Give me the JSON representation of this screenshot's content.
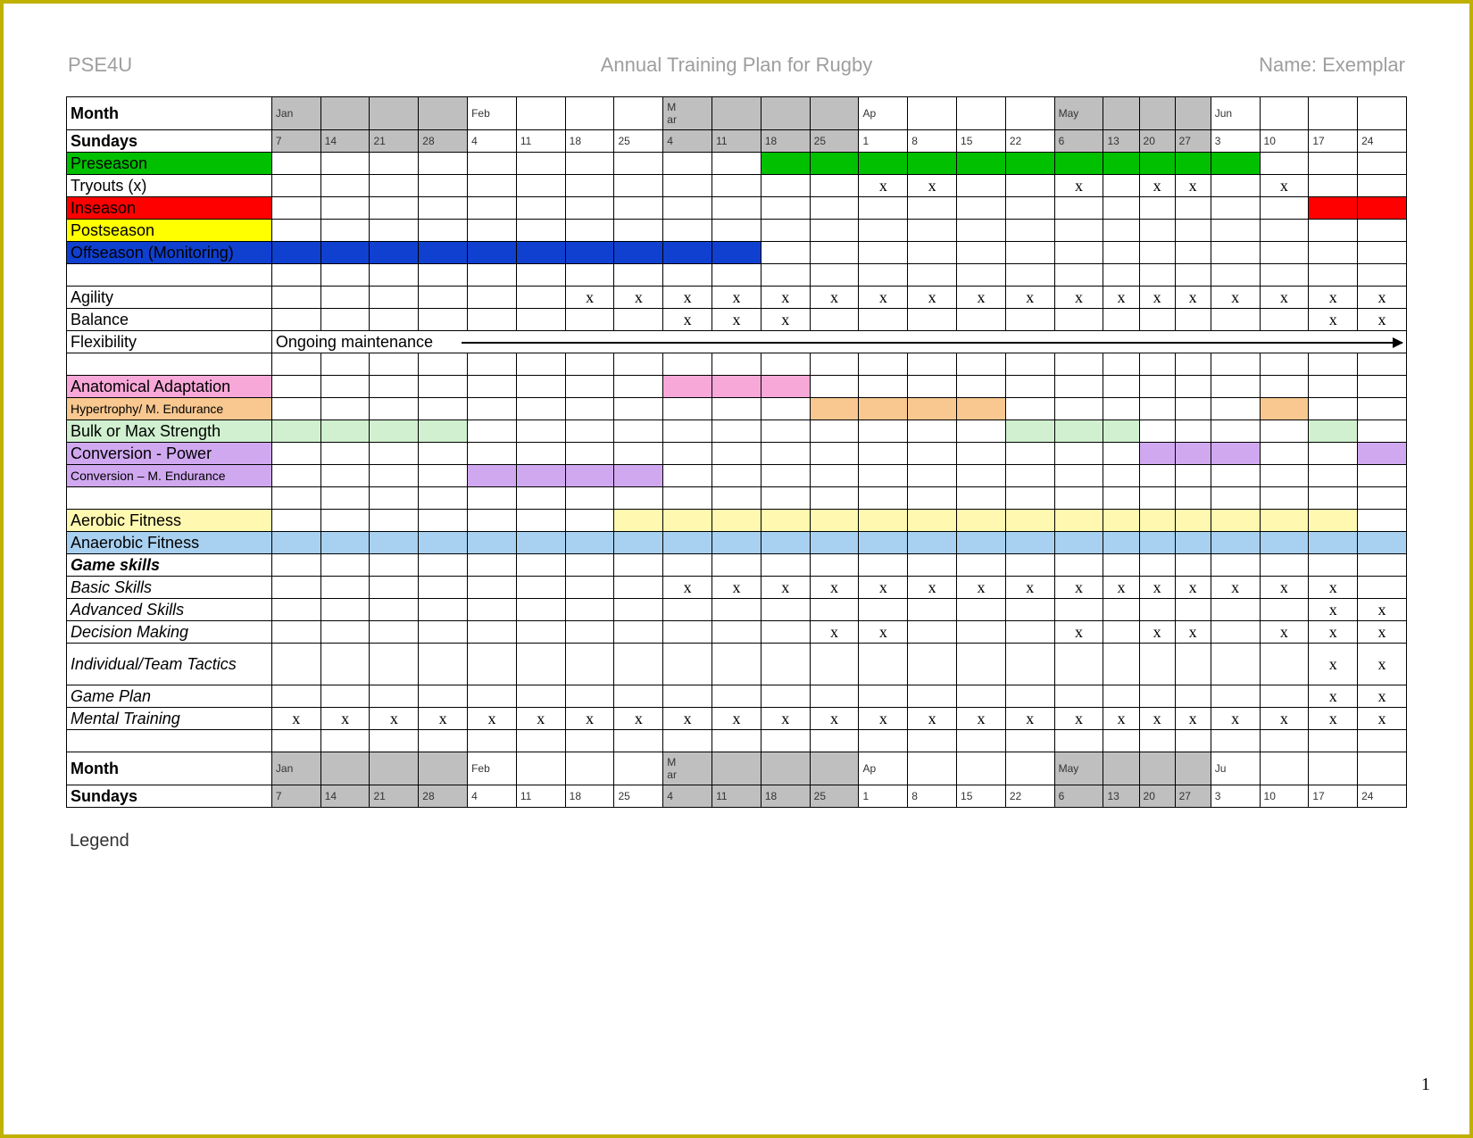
{
  "header": {
    "left": "PSE4U",
    "center": "Annual Training Plan for Rugby",
    "right": "Name: Exemplar"
  },
  "months": {
    "label": "Month",
    "cells": [
      "Jan",
      "",
      "",
      "",
      "Feb",
      "",
      "",
      "",
      "M ar",
      "",
      "",
      "",
      "Ap",
      "",
      "",
      "",
      "May",
      "",
      "",
      "",
      "Jun",
      "",
      "",
      ""
    ],
    "gray": [
      0,
      1,
      2,
      3,
      8,
      9,
      10,
      11,
      16,
      17,
      18,
      19
    ]
  },
  "sundays": {
    "label": "Sundays",
    "cells": [
      "7",
      "14",
      "21",
      "28",
      "4",
      "11",
      "18",
      "25",
      "4",
      "11",
      "18",
      "25",
      "1",
      "8",
      "15",
      "22",
      "6",
      "13",
      "20",
      "27",
      "3",
      "10",
      "17",
      "24"
    ],
    "gray": [
      0,
      1,
      2,
      3,
      8,
      9,
      10,
      11,
      16,
      17,
      18,
      19
    ]
  },
  "rows": [
    {
      "id": "preseason",
      "label": "Preseason",
      "labClass": "green",
      "fills": {
        "10": "green",
        "11": "green",
        "12": "green",
        "13": "green",
        "14": "green",
        "15": "green",
        "16": "green",
        "17": "green",
        "18": "green",
        "19": "green",
        "20": "green"
      }
    },
    {
      "id": "tryouts",
      "label": "Tryouts (x)",
      "x": [
        12,
        13,
        16,
        18,
        19,
        21
      ]
    },
    {
      "id": "inseason",
      "label": "Inseason",
      "labClass": "red",
      "fills": {
        "22": "red",
        "23": "red"
      }
    },
    {
      "id": "postseason",
      "label": "Postseason",
      "labClass": "yellow"
    },
    {
      "id": "offseason",
      "label": "Offseason (Monitoring)",
      "labClass": "darkblue",
      "fills": {
        "0": "darkblue",
        "1": "darkblue",
        "2": "darkblue",
        "3": "darkblue",
        "4": "darkblue",
        "5": "darkblue",
        "6": "darkblue",
        "7": "darkblue",
        "8": "darkblue",
        "9": "darkblue"
      }
    },
    {
      "id": "blank1",
      "label": ""
    },
    {
      "id": "agility",
      "label": "Agility",
      "x": [
        6,
        7,
        8,
        9,
        10,
        11,
        12,
        13,
        14,
        15,
        16,
        17,
        18,
        19,
        20,
        21,
        22,
        23
      ]
    },
    {
      "id": "balance",
      "label": "Balance",
      "x": [
        8,
        9,
        10,
        22,
        23
      ]
    },
    {
      "id": "flexibility",
      "label": "Flexibility",
      "note": "Ongoing maintenance",
      "noteStart": 0,
      "arrowStart": 4,
      "arrowEnd": 24
    },
    {
      "id": "blank2",
      "label": ""
    },
    {
      "id": "anatomical",
      "label": "Anatomical Adaptation",
      "labClass": "pink",
      "fills": {
        "8": "pink",
        "9": "pink",
        "10": "pink"
      }
    },
    {
      "id": "hypertrophy",
      "label": "Hypertrophy/ M. Endurance",
      "labClass": "peach",
      "labSmall": true,
      "fills": {
        "11": "peach",
        "12": "peach",
        "13": "peach",
        "14": "peach",
        "21": "peach"
      }
    },
    {
      "id": "bulk",
      "label": "Bulk or Max Strength",
      "labClass": "mint",
      "fills": {
        "0": "mint",
        "1": "mint",
        "2": "mint",
        "3": "mint",
        "15": "mint",
        "16": "mint",
        "17": "mint",
        "22": "mint"
      }
    },
    {
      "id": "conv-power",
      "label": "Conversion - Power",
      "labClass": "lav",
      "fills": {
        "18": "lav",
        "19": "lav",
        "20": "lav",
        "23": "lav"
      }
    },
    {
      "id": "conv-end",
      "label": "Conversion – M. Endurance",
      "labClass": "lav",
      "labSmall": true,
      "fills": {
        "4": "lav",
        "5": "lav",
        "6": "lav",
        "7": "lav"
      }
    },
    {
      "id": "blank3",
      "label": ""
    },
    {
      "id": "aerobic",
      "label": "Aerobic Fitness",
      "labClass": "cream",
      "fills": {
        "7": "cream",
        "8": "cream",
        "9": "cream",
        "10": "cream",
        "11": "cream",
        "12": "cream",
        "13": "cream",
        "14": "cream",
        "15": "cream",
        "16": "cream",
        "17": "cream",
        "18": "cream",
        "19": "cream",
        "20": "cream",
        "21": "cream",
        "22": "cream"
      }
    },
    {
      "id": "anaerobic",
      "label": "Anaerobic Fitness",
      "labClass": "sky",
      "fills": {
        "0": "sky",
        "1": "sky",
        "2": "sky",
        "3": "sky",
        "4": "sky",
        "5": "sky",
        "6": "sky",
        "7": "sky",
        "8": "sky",
        "9": "sky",
        "10": "sky",
        "11": "sky",
        "12": "sky",
        "13": "sky",
        "14": "sky",
        "15": "sky",
        "16": "sky",
        "17": "sky",
        "18": "sky",
        "19": "sky",
        "20": "sky",
        "21": "sky",
        "22": "sky",
        "23": "sky"
      }
    },
    {
      "id": "gameskills",
      "label": "Game skills",
      "rowClass": "row-game-skills"
    },
    {
      "id": "basic",
      "label": "Basic Skills",
      "rowClass": "row-italic",
      "x": [
        8,
        9,
        10,
        11,
        12,
        13,
        14,
        15,
        16,
        17,
        18,
        19,
        20,
        21,
        22
      ]
    },
    {
      "id": "advanced",
      "label": "Advanced Skills",
      "rowClass": "row-italic",
      "x": [
        22,
        23
      ]
    },
    {
      "id": "decision",
      "label": "Decision Making",
      "rowClass": "row-italic",
      "x": [
        11,
        12,
        16,
        18,
        19,
        21,
        22,
        23
      ]
    },
    {
      "id": "tactics",
      "label": "Individual/Team Tactics",
      "rowClass": "row-italic",
      "tall": true,
      "x": [
        22,
        23
      ]
    },
    {
      "id": "gameplan",
      "label": "Game Plan",
      "rowClass": "row-italic",
      "x": [
        22,
        23
      ]
    },
    {
      "id": "mental",
      "label": "Mental Training",
      "rowClass": "row-italic",
      "x": [
        0,
        1,
        2,
        3,
        4,
        5,
        6,
        7,
        8,
        9,
        10,
        11,
        12,
        13,
        14,
        15,
        16,
        17,
        18,
        19,
        20,
        21,
        22,
        23
      ]
    },
    {
      "id": "blank4",
      "label": ""
    }
  ],
  "months_bottom": {
    "label": "Month",
    "cells": [
      "Jan",
      "",
      "",
      "",
      "Feb",
      "",
      "",
      "",
      "M ar",
      "",
      "",
      "",
      "Ap",
      "",
      "",
      "",
      "May",
      "",
      "",
      "",
      "Ju",
      "",
      "",
      ""
    ],
    "gray": [
      0,
      1,
      2,
      3,
      8,
      9,
      10,
      11,
      16,
      17,
      18,
      19
    ]
  },
  "sundays_bottom": {
    "label": "Sundays",
    "cells": [
      "7",
      "14",
      "21",
      "28",
      "4",
      "11",
      "18",
      "25",
      "4",
      "11",
      "18",
      "25",
      "1",
      "8",
      "15",
      "22",
      "6",
      "13",
      "20",
      "27",
      "3",
      "10",
      "17",
      "24"
    ],
    "gray": [
      0,
      1,
      2,
      3,
      8,
      9,
      10,
      11,
      16,
      17,
      18,
      19
    ]
  },
  "legend": "Legend",
  "pagenum": "1",
  "narrowCols": [
    17,
    18,
    19
  ]
}
